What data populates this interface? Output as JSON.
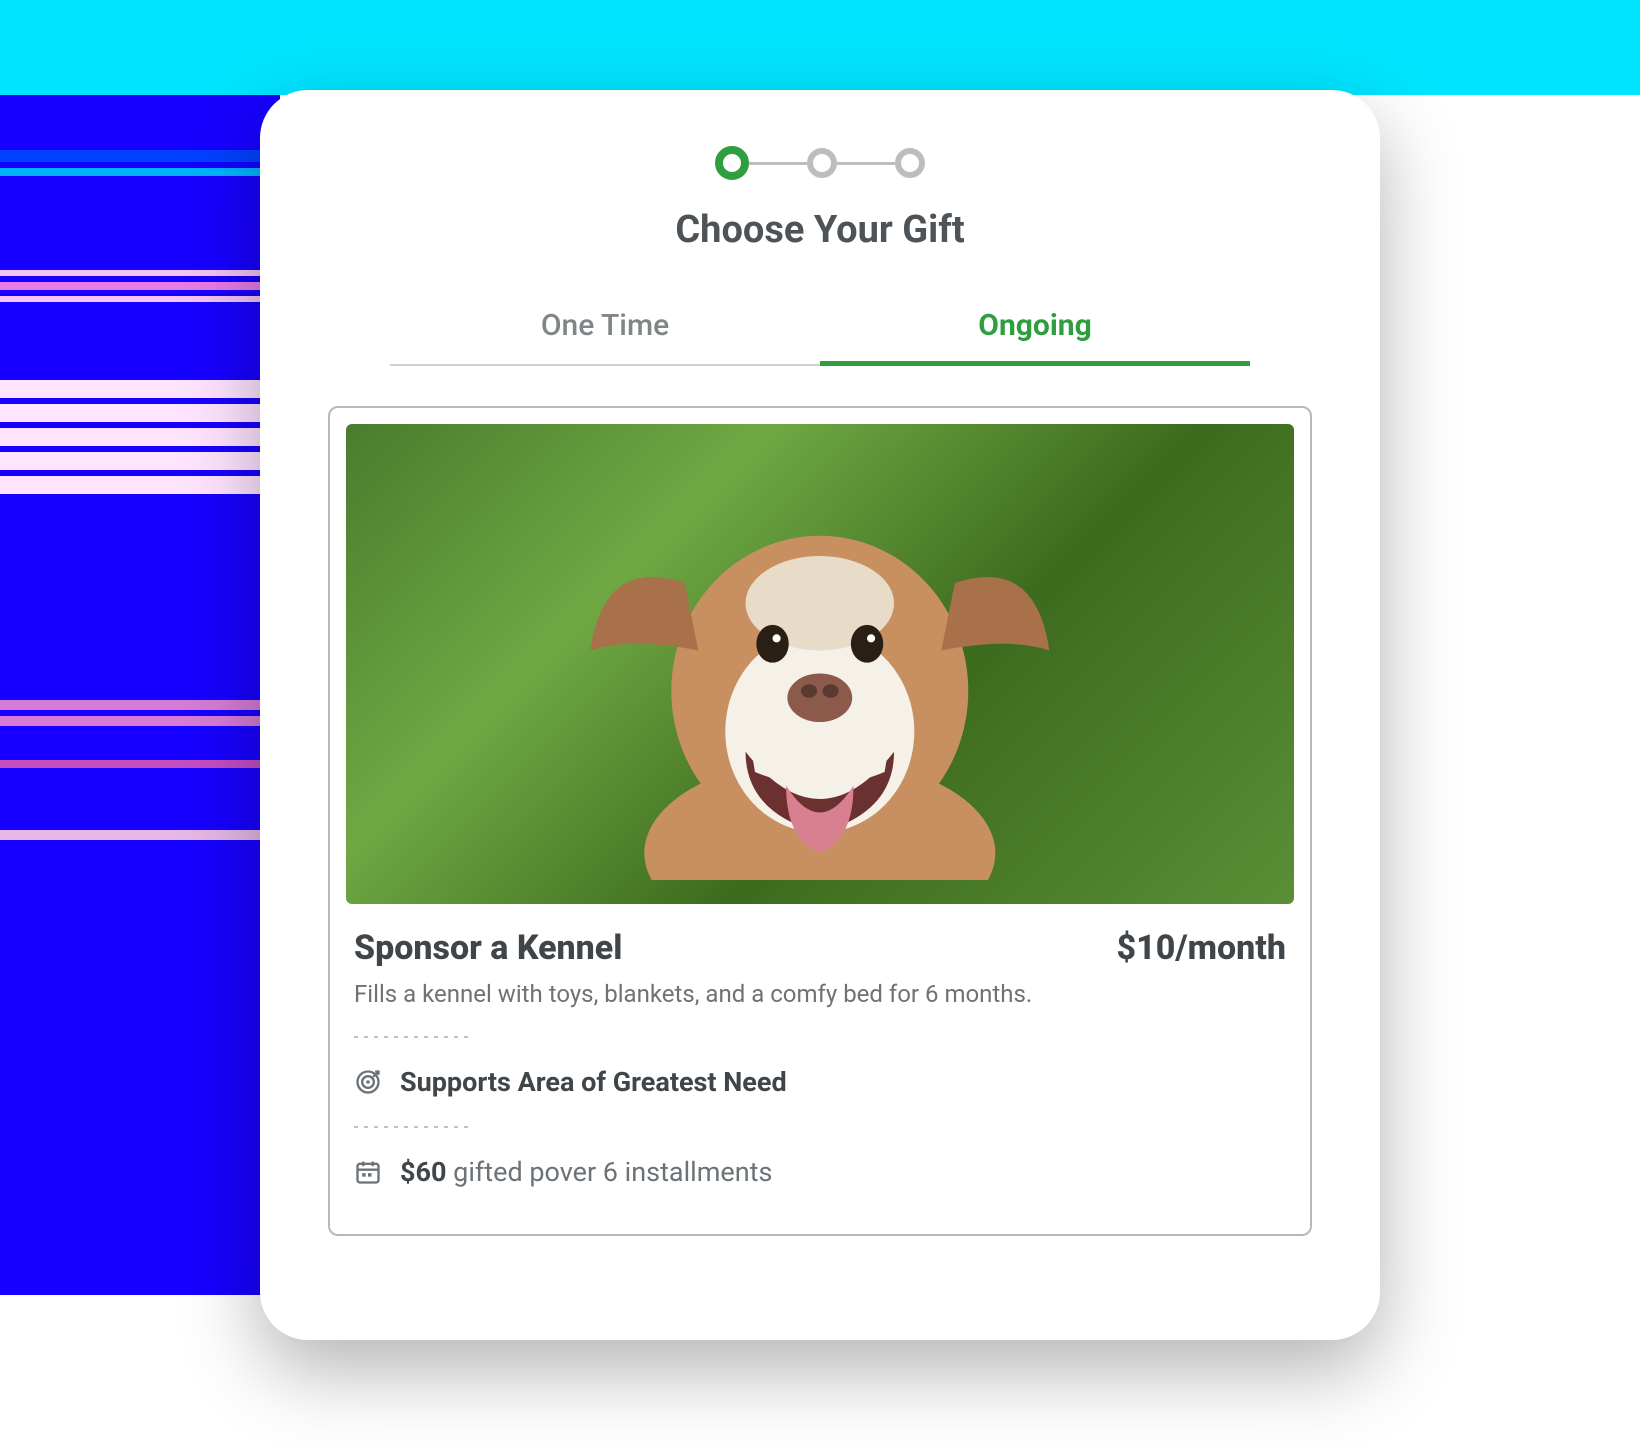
{
  "header": {
    "title": "Choose Your Gift"
  },
  "stepper": {
    "current": 1,
    "total": 3
  },
  "tabs": {
    "one_time": "One Time",
    "ongoing": "Ongoing",
    "active": "ongoing"
  },
  "gift": {
    "title": "Sponsor a Kennel",
    "price": "$10/month",
    "description": "Fills a kennel with toys, blankets, and a comfy bed for 6 months.",
    "supports_label": "Supports Area of Greatest Need",
    "installment_amount": "$60",
    "installment_suffix": " gifted pover 6 installments"
  },
  "icons": {
    "target": "target-icon",
    "calendar": "calendar-icon"
  },
  "colors": {
    "accent": "#2E9E3F",
    "text_primary": "#3F4549",
    "text_secondary": "#6C7275"
  }
}
